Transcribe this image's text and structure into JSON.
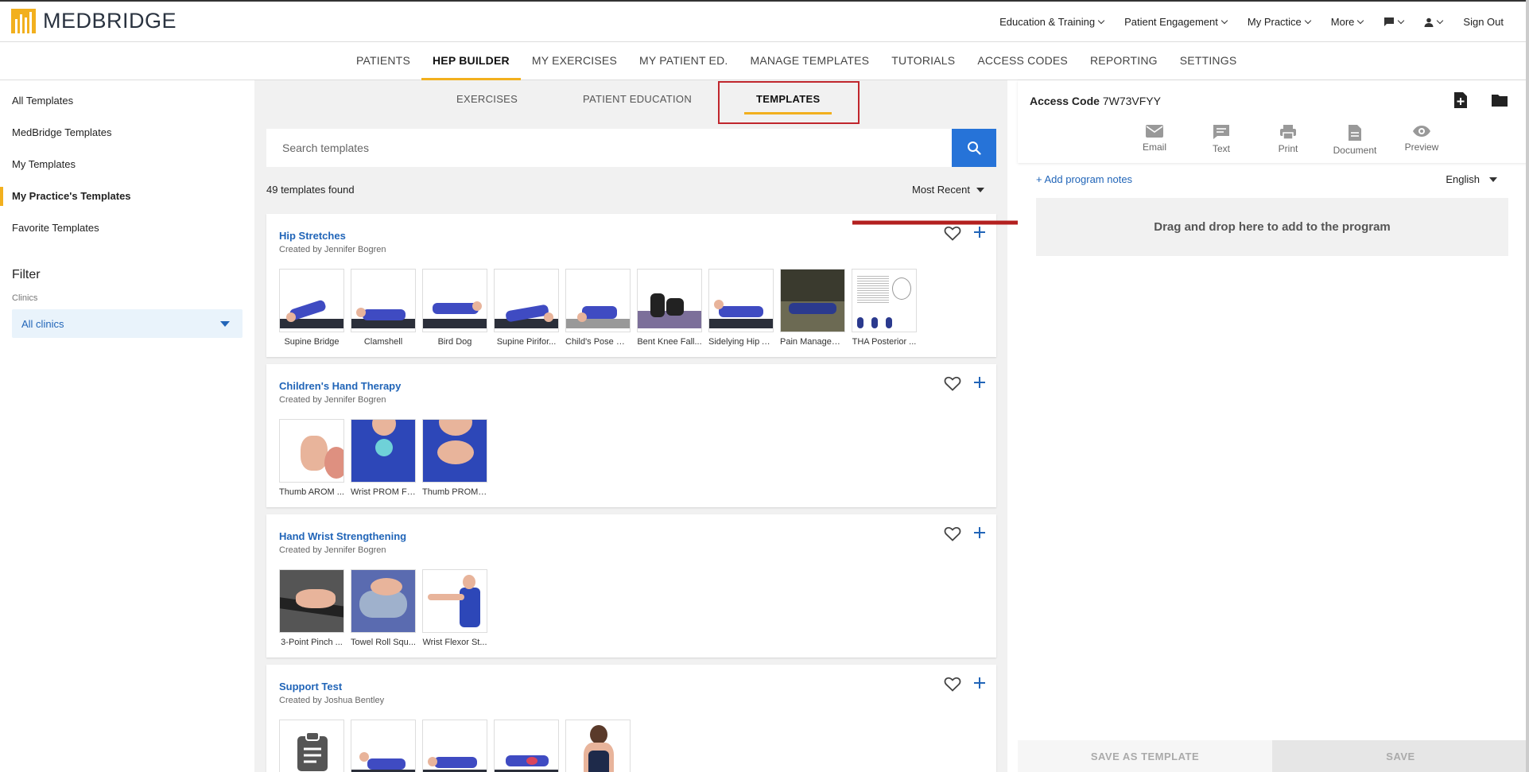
{
  "brand": {
    "name": "MEDBRIDGE",
    "color": "#f2b01e"
  },
  "topnav": {
    "items": [
      {
        "label": "Education & Training"
      },
      {
        "label": "Patient Engagement"
      },
      {
        "label": "My Practice"
      },
      {
        "label": "More"
      }
    ],
    "sign_out": "Sign Out"
  },
  "mainnav": {
    "items": [
      "PATIENTS",
      "HEP BUILDER",
      "MY EXERCISES",
      "MY PATIENT ED.",
      "MANAGE TEMPLATES",
      "TUTORIALS",
      "ACCESS CODES",
      "REPORTING",
      "SETTINGS"
    ],
    "active": "HEP BUILDER"
  },
  "sidebar": {
    "items": [
      "All Templates",
      "MedBridge Templates",
      "My Templates",
      "My Practice's Templates",
      "Favorite Templates"
    ],
    "active": "My Practice's Templates",
    "filter_title": "Filter",
    "clinics_label": "Clinics",
    "clinics_value": "All clinics"
  },
  "subtabs": {
    "items": [
      "EXERCISES",
      "PATIENT EDUCATION",
      "TEMPLATES"
    ],
    "active": "TEMPLATES"
  },
  "search": {
    "placeholder": "Search templates"
  },
  "results": {
    "count_text": "49 templates found",
    "sort": "Most Recent"
  },
  "templates": [
    {
      "title": "Hip Stretches",
      "author": "Created by Jennifer Bogren",
      "items": [
        "Supine Bridge",
        "Clamshell",
        "Bird Dog",
        "Supine Pirifor...",
        "Child's Pose St...",
        "Bent Knee Fall...",
        "Sidelying Hip A...",
        "Pain Managem...",
        "THA Posterior ..."
      ]
    },
    {
      "title": "Children's Hand Therapy",
      "author": "Created by Jennifer Bogren",
      "items": [
        "Thumb AROM ...",
        "Wrist PROM Fl...",
        "Thumb PROM ..."
      ]
    },
    {
      "title": "Hand Wrist Strengthening",
      "author": "Created by Jennifer Bogren",
      "items": [
        "3-Point Pinch ...",
        "Towel Roll Squ...",
        "Wrist Flexor St..."
      ]
    },
    {
      "title": "Support Test",
      "author": "Created by Joshua Bentley",
      "items": []
    }
  ],
  "rightpanel": {
    "access_code_label": "Access Code",
    "access_code_value": "7W73VFYY",
    "actions": [
      "Email",
      "Text",
      "Print",
      "Document",
      "Preview"
    ],
    "add_notes": "+ Add program notes",
    "language": "English",
    "dropzone": "Drag and drop here to add to the program",
    "save_template": "SAVE AS TEMPLATE",
    "save": "SAVE"
  },
  "colors": {
    "link": "#2165b8",
    "primary_button": "#2673d8",
    "highlight_box": "#c0262d",
    "accent": "#f2b01e"
  }
}
